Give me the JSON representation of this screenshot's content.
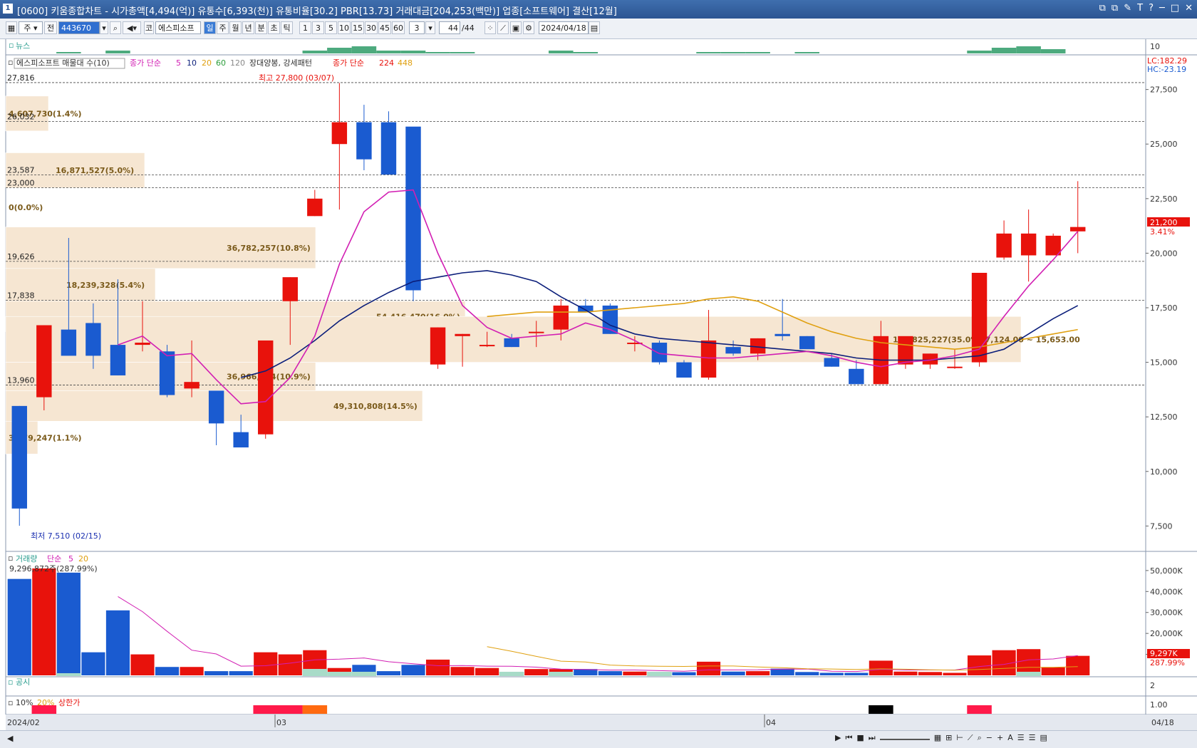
{
  "window": {
    "app_num": "1",
    "title": "[0600] 키움종합차트 - 시가총액[4,494(억)] 유통수[6,393(천)] 유통비율[30.2] PBR[13.73] 거래대금[204,253(백만)] 업종[소프트웨어] 결산[12월]",
    "buttons": [
      "⧉",
      "⧉",
      "✎",
      "T",
      "?",
      "─",
      "□",
      "✕"
    ]
  },
  "toolbar": {
    "period_unit": "주",
    "jeon": "전",
    "code": "443670",
    "market": "코",
    "stock_name": "에스피소프",
    "periods": [
      "일",
      "주",
      "월",
      "년",
      "분",
      "초",
      "틱"
    ],
    "active_period": "일",
    "minutes": [
      "1",
      "3",
      "5",
      "10",
      "15",
      "30",
      "45",
      "60"
    ],
    "tick_count": "3",
    "count": "44",
    "count_total": "/44",
    "date": "2024/04/18"
  },
  "news_panel": {
    "label": "뉴스",
    "axis_label": "10"
  },
  "price_panel": {
    "legend_stock": "에스피소프트 매물대 수(10)",
    "legend_ma_prefix": "종가 단순",
    "legend_ma_periods": [
      "5",
      "10",
      "20",
      "60",
      "120"
    ],
    "legend_pattern": "장대양봉, 강세패턴",
    "legend_ma2_prefix": "종가 단순",
    "legend_ma2_periods": [
      "224",
      "448"
    ],
    "high_label": "최고 27,800 (03/07)",
    "low_label": "최저 7,510 (02/15)",
    "lc": "LC:182.29",
    "hc": "HC:-23.19",
    "current_price": "21,200",
    "current_change": "3.41%",
    "y_ticks": [
      "27,500",
      "25,000",
      "22,500",
      "20,000",
      "17,500",
      "15,000",
      "12,500",
      "10,000",
      "7,500"
    ],
    "left_levels": [
      "27,816",
      "26,032",
      "23,587",
      "23,000",
      "19,626",
      "17,838",
      "13,960"
    ],
    "volume_profile": [
      "4,607,730(1.4%)",
      "16,871,527(5.0%)",
      "0(0.0%)",
      "36,782,257(10.8%)",
      "18,239,328(5.4%)",
      "54,416,470(16.0%)",
      "118,825,227(35.0%)",
      "36,966,924(10.9%)",
      "49,310,808(14.5%)",
      "3,679,247(1.1%)"
    ],
    "range_label": "17,124.00 ~ 15,653.00"
  },
  "volume_panel": {
    "label": "거래량",
    "ma_label": "단순",
    "ma_periods": [
      "5",
      "20"
    ],
    "top_value": "9,296,872주(287.99%)",
    "y_ticks": [
      "50,000K",
      "40,000K",
      "30,000K",
      "20,000K",
      "10,000K"
    ],
    "current_value": "9,297K",
    "current_pct": "287.99%"
  },
  "disclosure_panel": {
    "label": "공시",
    "axis_label": "2"
  },
  "limit_panel": {
    "labels": [
      "10%",
      "20%",
      "상한가"
    ],
    "axis_label": "1.00"
  },
  "x_axis": {
    "labels": [
      "2024/02",
      "03",
      "04"
    ],
    "end_label": "04/18"
  },
  "colors": {
    "up": "#e8120c",
    "down": "#1a5bd0",
    "ma5": "#d21fb3",
    "ma10": "#0b1e7a",
    "ma20": "#e0a010",
    "profile": "#f6e6d2"
  },
  "chart_data": {
    "type": "candlestick",
    "ohlc": [
      [
        13000,
        13000,
        7510,
        8300
      ],
      [
        13400,
        16700,
        12800,
        16700
      ],
      [
        16500,
        20700,
        15400,
        15300
      ],
      [
        16800,
        17700,
        14700,
        15300
      ],
      [
        15800,
        18800,
        14400,
        14400
      ],
      [
        15800,
        17800,
        15500,
        15900
      ],
      [
        15500,
        15800,
        13400,
        13500
      ],
      [
        13800,
        16000,
        13400,
        14100
      ],
      [
        13700,
        13600,
        11200,
        12200
      ],
      [
        11800,
        12600,
        11100,
        11100
      ],
      [
        11700,
        16000,
        11500,
        16000
      ],
      [
        17800,
        18900,
        15800,
        18900
      ],
      [
        21700,
        22900,
        21700,
        22500
      ],
      [
        25000,
        27800,
        22000,
        26000
      ],
      [
        26000,
        26800,
        23800,
        24300
      ],
      [
        26000,
        26500,
        23600,
        23600
      ],
      [
        25800,
        24800,
        17800,
        18300
      ],
      [
        14900,
        16600,
        14700,
        16600
      ],
      [
        16200,
        16300,
        14800,
        16300
      ],
      [
        15800,
        16400,
        15700,
        15800
      ],
      [
        16100,
        16300,
        15700,
        15700
      ],
      [
        16400,
        16900,
        15700,
        16400
      ],
      [
        16500,
        17900,
        16000,
        17600
      ],
      [
        17600,
        17900,
        17500,
        17300
      ],
      [
        17600,
        17700,
        16300,
        16300
      ],
      [
        15900,
        16200,
        15500,
        15900
      ],
      [
        15900,
        16000,
        14900,
        15000
      ],
      [
        15000,
        15100,
        14400,
        14300
      ],
      [
        14300,
        17400,
        14200,
        16000
      ],
      [
        15700,
        16000,
        15300,
        15400
      ],
      [
        15400,
        16100,
        15100,
        16100
      ],
      [
        16300,
        17900,
        16000,
        16200
      ],
      [
        16200,
        16200,
        15700,
        15600
      ],
      [
        15200,
        15400,
        14800,
        14800
      ],
      [
        14700,
        15100,
        14100,
        14000
      ],
      [
        14000,
        16900,
        14000,
        16200
      ],
      [
        14900,
        16000,
        14700,
        16200
      ],
      [
        14900,
        15400,
        14700,
        15400
      ],
      [
        14800,
        15600,
        14700,
        14800
      ],
      [
        15000,
        19000,
        14800,
        19100
      ],
      [
        19800,
        21500,
        19700,
        20900
      ],
      [
        19900,
        22000,
        18700,
        20900
      ],
      [
        19900,
        20900,
        19900,
        20800
      ],
      [
        21000,
        23300,
        20000,
        21200
      ]
    ],
    "volume_k": [
      46000,
      51000,
      49000,
      11000,
      31000,
      10000,
      4000,
      4000,
      2000,
      2000,
      11000,
      10000,
      12000,
      3500,
      5000,
      2000,
      5000,
      7500,
      4000,
      3500,
      1500,
      3000,
      3000,
      3000,
      2000,
      1800,
      1400,
      1500,
      6500,
      1800,
      2000,
      3200,
      1600,
      1200,
      1200,
      7000,
      1800,
      1600,
      1200,
      9500,
      12000,
      12500,
      3800,
      9300
    ],
    "ma5": [
      null,
      null,
      null,
      null,
      15800,
      16200,
      15300,
      15400,
      14200,
      13100,
      13200,
      14300,
      16200,
      19500,
      21900,
      22800,
      22900,
      20000,
      17600,
      16600,
      16100,
      16200,
      16300,
      16800,
      16500,
      16000,
      15400,
      15300,
      15200,
      15200,
      15300,
      15400,
      15500,
      15300,
      15000,
      14800,
      15000,
      15100,
      15300,
      15600,
      17100,
      18500,
      19700,
      21000
    ],
    "ma10": [
      null,
      null,
      null,
      null,
      null,
      null,
      null,
      null,
      null,
      14300,
      14600,
      15200,
      16000,
      16900,
      17600,
      18200,
      18700,
      18900,
      19100,
      19200,
      19000,
      18700,
      18000,
      17400,
      16700,
      16300,
      16100,
      16000,
      15900,
      15800,
      15700,
      15600,
      15500,
      15400,
      15200,
      15100,
      15100,
      15100,
      15200,
      15300,
      15600,
      16300,
      17000,
      17600
    ],
    "ma20": [
      null,
      null,
      null,
      null,
      null,
      null,
      null,
      null,
      null,
      null,
      null,
      null,
      null,
      null,
      null,
      null,
      null,
      null,
      null,
      17100,
      17200,
      17300,
      17300,
      17300,
      17400,
      17500,
      17600,
      17700,
      17900,
      18000,
      17800,
      17300,
      16800,
      16400,
      16100,
      15900,
      15800,
      15700,
      15600,
      15700,
      15900,
      16100,
      16300,
      16500
    ],
    "volume_ma5": [
      null,
      null,
      null,
      null,
      null,
      null,
      null,
      null,
      null,
      null,
      null,
      null,
      null,
      null,
      null,
      null,
      null,
      null,
      null,
      null,
      null,
      null,
      null,
      null,
      null,
      null,
      null,
      null,
      null,
      null,
      null,
      null,
      null,
      null,
      null,
      null,
      null,
      null,
      null,
      null,
      null,
      null,
      null,
      null
    ],
    "y_range": [
      6500,
      28500
    ],
    "volume_range_k": [
      0,
      52000
    ]
  }
}
